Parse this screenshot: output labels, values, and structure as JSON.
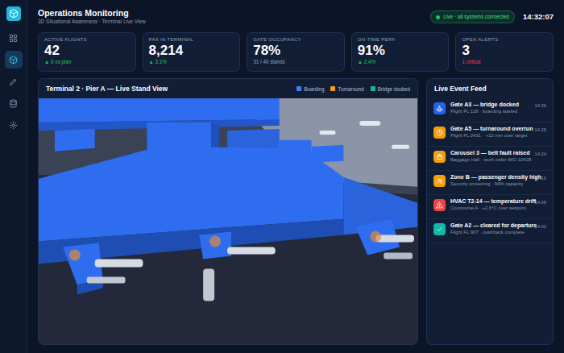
{
  "header": {
    "title": "Operations Monitoring",
    "subtitle": "3D Situational Awareness · Terminal Live View",
    "status": "Live · all systems connected",
    "time": "14:32:07"
  },
  "sidebar": {
    "items": [
      {
        "kind": "dashboard",
        "selected": false
      },
      {
        "kind": "model",
        "selected": true
      },
      {
        "kind": "edit",
        "selected": false
      },
      {
        "kind": "data",
        "selected": false
      },
      {
        "kind": "settings",
        "selected": false
      }
    ]
  },
  "kpis": [
    {
      "label": "ACTIVE FLIGHTS",
      "value": "42",
      "note": "▲ 6 vs plan",
      "kind": "up"
    },
    {
      "label": "PAX IN TERMINAL",
      "value": "8,214",
      "note": "▲ 3.1%",
      "kind": "up"
    },
    {
      "label": "GATE OCCUPANCY",
      "value": "78%",
      "note": "31 / 40 stands",
      "kind": "neutral"
    },
    {
      "label": "ON-TIME PERF.",
      "value": "91%",
      "note": "▲ 2.4%",
      "kind": "up"
    },
    {
      "label": "OPEN ALERTS",
      "value": "3",
      "note": "1 critical",
      "kind": "critical"
    }
  ],
  "view": {
    "title": "Terminal 2 · Pier A — Live Stand View",
    "legend": [
      {
        "label": "Boarding",
        "color": "#3b82f6"
      },
      {
        "label": "Turnaround",
        "color": "#f59e0b"
      },
      {
        "label": "Bridge docked",
        "color": "#14b8a6"
      }
    ]
  },
  "feed": {
    "title": "Live Event Feed",
    "events": [
      {
        "title": "Gate A3 — bridge docked",
        "detail": "Flight FL 118 · boarding started",
        "time": "14:30",
        "kind": "bridge",
        "color": "#2563eb"
      },
      {
        "title": "Gate A5 — turnaround overrun",
        "detail": "Flight FL 2431 · +12 min over target",
        "time": "14:29",
        "kind": "turnaround",
        "color": "#f59e0b"
      },
      {
        "title": "Carousel 3 — belt fault raised",
        "detail": "Baggage Hall · work order WO-10428",
        "time": "14:24",
        "kind": "baggage",
        "color": "#f59e0b"
      },
      {
        "title": "Zone B — passenger density high",
        "detail": "Security screening · 94% capacity",
        "time": "14:16",
        "kind": "crowd",
        "color": "#f59e0b"
      },
      {
        "title": "HVAC T2-14 — temperature drift",
        "detail": "Concourse A · +2.6°C over setpoint",
        "time": "14:09",
        "kind": "hvac",
        "color": "#ef4444"
      },
      {
        "title": "Gate A2 — cleared for departure",
        "detail": "Flight FL 907 · pushback complete",
        "time": "14:02",
        "kind": "departure",
        "color": "#14b8a6"
      }
    ]
  }
}
